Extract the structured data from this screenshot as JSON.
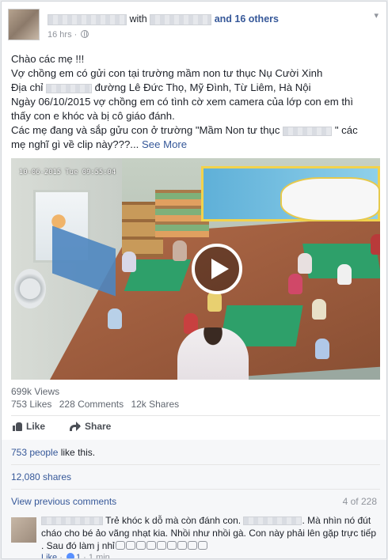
{
  "header": {
    "with_text": "with",
    "others": "and 16 others",
    "time": "16 hrs",
    "separator": "·"
  },
  "post": {
    "lines": [
      "Chào các mẹ !!!",
      "Vợ chồng em có gửi con tại trường mầm non tư thục Nụ Cười Xinh",
      "Ngày 06/10/2015 vợ chồng em có tình cờ xem camera của lớp con em thì",
      "thấy con e khóc và bị cô giáo đánh."
    ],
    "address_prefix": "Địa chỉ",
    "address_rest": "đường Lê Đức Thọ, Mỹ Đình, Từ Liêm, Hà Nội",
    "last_prefix": "Các mẹ đang và sắp gửu con ở trường \"Mầm Non tư thục",
    "last_suffix": "\" các",
    "last_line2": "mẹ nghĩ gì về clip này???...",
    "see_more": "See More"
  },
  "video": {
    "timestamp": "10-06-2015 Tue 09:55:04"
  },
  "stats": {
    "views": "699k Views",
    "likes": "753 Likes",
    "comments": "228 Comments",
    "shares": "12k Shares"
  },
  "actions": {
    "like": "Like",
    "share": "Share"
  },
  "summary": {
    "likes_link": "753 people",
    "likes_rest": " like this.",
    "shares": "12,080 shares"
  },
  "comments": {
    "view_previous": "View previous comments",
    "count": "4 of 228",
    "first_part": "Trẻ khóc k dỗ mà còn đánh con.",
    "second_part": ". Mà nhìn nó đút",
    "line2": "cháo cho bé ảo vãng nhạt kia. Nhồi như nhồi gà. Con này phải lên gặp trực tiếp",
    "line3": ". Sau đó làm j nhỉ",
    "like_label": "Like",
    "like_count": "1",
    "time": "1 min",
    "dot": "·"
  }
}
